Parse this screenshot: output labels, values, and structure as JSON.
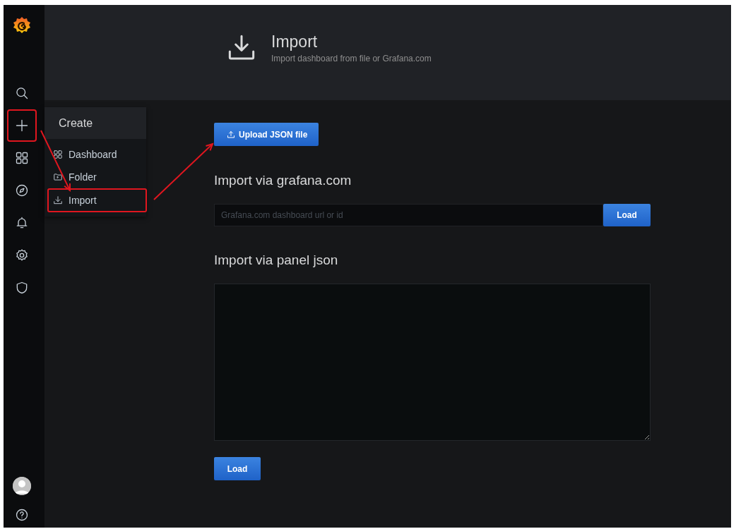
{
  "nav_icons": [
    {
      "kind": "search",
      "highlighted": false
    },
    {
      "kind": "plus",
      "highlighted": true
    },
    {
      "kind": "grid",
      "highlighted": false
    },
    {
      "kind": "compass",
      "highlighted": false
    },
    {
      "kind": "bell",
      "highlighted": false
    },
    {
      "kind": "gear",
      "highlighted": false
    },
    {
      "kind": "shield",
      "highlighted": false
    }
  ],
  "nav_bottom": [
    {
      "kind": "avatar"
    },
    {
      "kind": "help"
    }
  ],
  "create_menu": {
    "title": "Create",
    "items": [
      {
        "kind": "grid",
        "label": "Dashboard",
        "highlighted": false
      },
      {
        "kind": "folder",
        "label": "Folder",
        "highlighted": false
      },
      {
        "kind": "download",
        "label": "Import",
        "highlighted": true
      }
    ]
  },
  "header": {
    "title": "Import",
    "subtitle": "Import dashboard from file or Grafana.com"
  },
  "upload_button": "Upload JSON file",
  "grafana_section": {
    "heading": "Import via grafana.com",
    "placeholder": "Grafana.com dashboard url or id",
    "button": "Load"
  },
  "json_section": {
    "heading": "Import via panel json",
    "button": "Load"
  },
  "annotation_arrows": true
}
